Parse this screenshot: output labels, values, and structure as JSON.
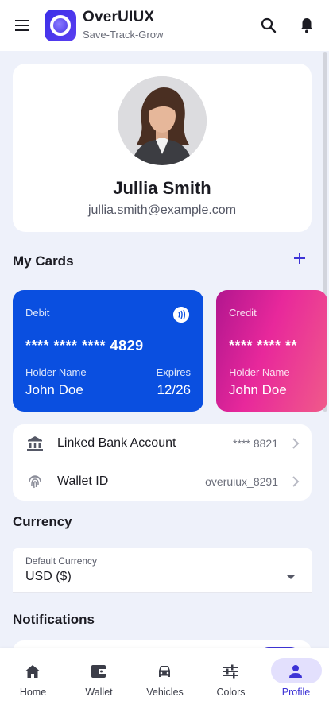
{
  "app": {
    "title": "OverUIUX",
    "subtitle": "Save-Track-Grow"
  },
  "header": {
    "menu_icon": "menu-icon",
    "search_icon": "search-icon",
    "notification_icon": "bell-icon"
  },
  "profile": {
    "name": "Jullia Smith",
    "email": "jullia.smith@example.com"
  },
  "cards_section": {
    "title": "My Cards",
    "add_icon": "plus-icon",
    "cards": [
      {
        "type": "Debit",
        "number": "**** **** **** 4829",
        "holder_label": "Holder Name",
        "holder": "John Doe",
        "expires_label": "Expires",
        "expires": "12/26",
        "color": "#0a4fe0"
      },
      {
        "type": "Credit",
        "number": "**** **** **",
        "holder_label": "Holder Name",
        "holder": "John Doe",
        "color": "#e8289b"
      }
    ]
  },
  "accounts": [
    {
      "label": "Linked Bank Account",
      "value": "**** 8821",
      "icon": "bank-icon"
    },
    {
      "label": "Wallet ID",
      "value": "overuiux_8291",
      "icon": "fingerprint-icon"
    }
  ],
  "currency": {
    "title": "Currency",
    "field_label": "Default Currency",
    "value": "USD ($)"
  },
  "notifications": {
    "title": "Notifications",
    "toggle_on": true
  },
  "bottom_nav": {
    "active": "Profile",
    "items": [
      {
        "label": "Home",
        "icon": "home-icon"
      },
      {
        "label": "Wallet",
        "icon": "wallet-icon"
      },
      {
        "label": "Vehicles",
        "icon": "car-icon"
      },
      {
        "label": "Colors",
        "icon": "sliders-icon"
      },
      {
        "label": "Profile",
        "icon": "person-icon"
      }
    ]
  },
  "colors": {
    "accent": "#3d33d6",
    "background": "#eef1fa",
    "debit_card": "#0a4fe0",
    "credit_card": "#e8289b"
  }
}
